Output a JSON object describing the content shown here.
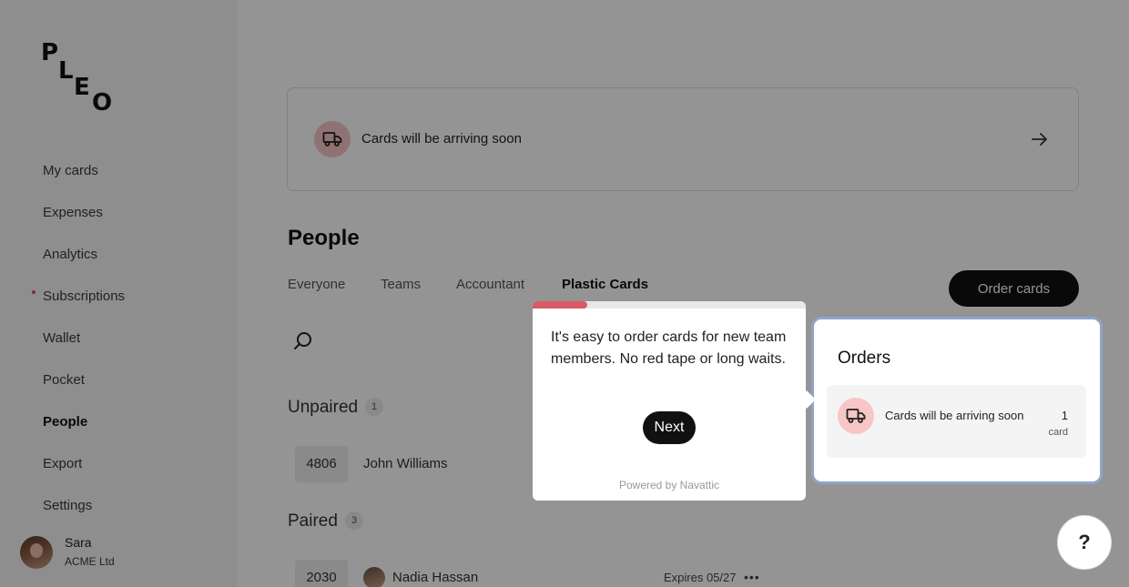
{
  "brand": {
    "logo_letters": [
      "P",
      "L",
      "E",
      "O"
    ]
  },
  "sidebar": {
    "items": [
      {
        "label": "My cards",
        "active": false,
        "dot": false
      },
      {
        "label": "Expenses",
        "active": false,
        "dot": false
      },
      {
        "label": "Analytics",
        "active": false,
        "dot": false
      },
      {
        "label": "Subscriptions",
        "active": false,
        "dot": true
      },
      {
        "label": "Wallet",
        "active": false,
        "dot": false
      },
      {
        "label": "Pocket",
        "active": false,
        "dot": false
      },
      {
        "label": "People",
        "active": true,
        "dot": false
      },
      {
        "label": "Export",
        "active": false,
        "dot": false
      },
      {
        "label": "Settings",
        "active": false,
        "dot": false
      }
    ],
    "user": {
      "name": "Sara",
      "company": "ACME Ltd"
    }
  },
  "banner": {
    "text": "Cards will be arriving soon"
  },
  "main": {
    "title": "People",
    "tabs": [
      {
        "label": "Everyone",
        "active": false
      },
      {
        "label": "Teams",
        "active": false
      },
      {
        "label": "Accountant",
        "active": false
      },
      {
        "label": "Plastic Cards",
        "active": true
      }
    ],
    "order_button": "Order cards",
    "unpaired": {
      "title": "Unpaired",
      "count": "1",
      "rows": [
        {
          "card": "4806",
          "name": "John Williams"
        }
      ]
    },
    "paired": {
      "title": "Paired",
      "count": "3",
      "rows": [
        {
          "card": "2030",
          "name": "Nadia Hassan",
          "expires": "Expires 05/27",
          "more": "•••"
        }
      ]
    }
  },
  "orders": {
    "title": "Orders",
    "item": {
      "text": "Cards will be arriving soon",
      "count": "1",
      "unit": "card"
    }
  },
  "tooltip": {
    "text": "It's easy to order cards for new team members. No red tape or long waits.",
    "next": "Next",
    "powered_by": "Powered by Navattic",
    "progress": 0.2
  },
  "help": {
    "label": "?"
  },
  "colors": {
    "accent": "#d85a66",
    "truck_bg": "#f6c7c6",
    "dark": "#111111"
  }
}
